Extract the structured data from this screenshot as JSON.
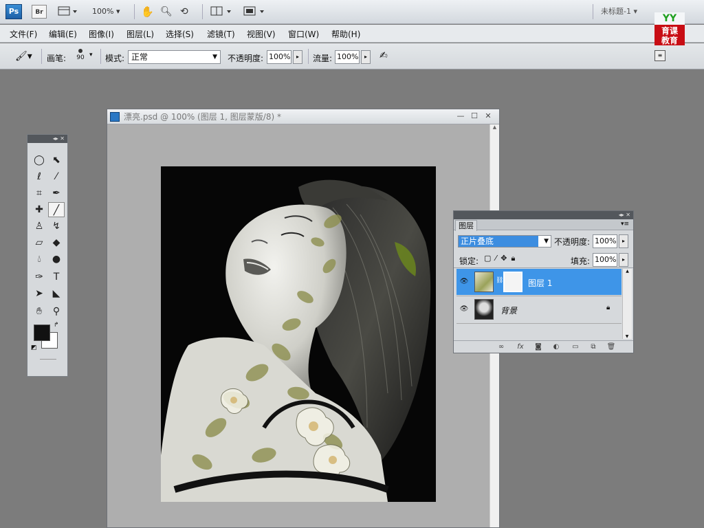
{
  "appbar": {
    "logo": "Ps",
    "bridge": "Br",
    "zoom": "100%",
    "doc_title": "未标题-1"
  },
  "menu": [
    "文件(F)",
    "编辑(E)",
    "图像(I)",
    "图层(L)",
    "选择(S)",
    "滤镜(T)",
    "视图(V)",
    "窗口(W)",
    "帮助(H)"
  ],
  "options": {
    "brush_label": "画笔:",
    "brush_size": "90",
    "mode_label": "模式:",
    "mode_value": "正常",
    "opacity_label": "不透明度:",
    "opacity_value": "100%",
    "flow_label": "流量:",
    "flow_value": "100%"
  },
  "edu_logo": {
    "yy": "YY",
    "line1": "育课",
    "line2": "教育"
  },
  "document": {
    "title": "漂亮.psd @ 100% (图层 1, 图层蒙版/8) *"
  },
  "layers_panel": {
    "tab": "图层",
    "blend_mode": "正片叠底",
    "opacity_label": "不透明度:",
    "opacity_value": "100%",
    "lock_label": "锁定:",
    "fill_label": "填充:",
    "fill_value": "100%",
    "layers": [
      {
        "name": "图层 1",
        "selected": true
      },
      {
        "name": "背景",
        "selected": false
      }
    ]
  },
  "colors": {
    "accent": "#3e95e8",
    "foreground": "#111111",
    "background": "#ffffff"
  }
}
